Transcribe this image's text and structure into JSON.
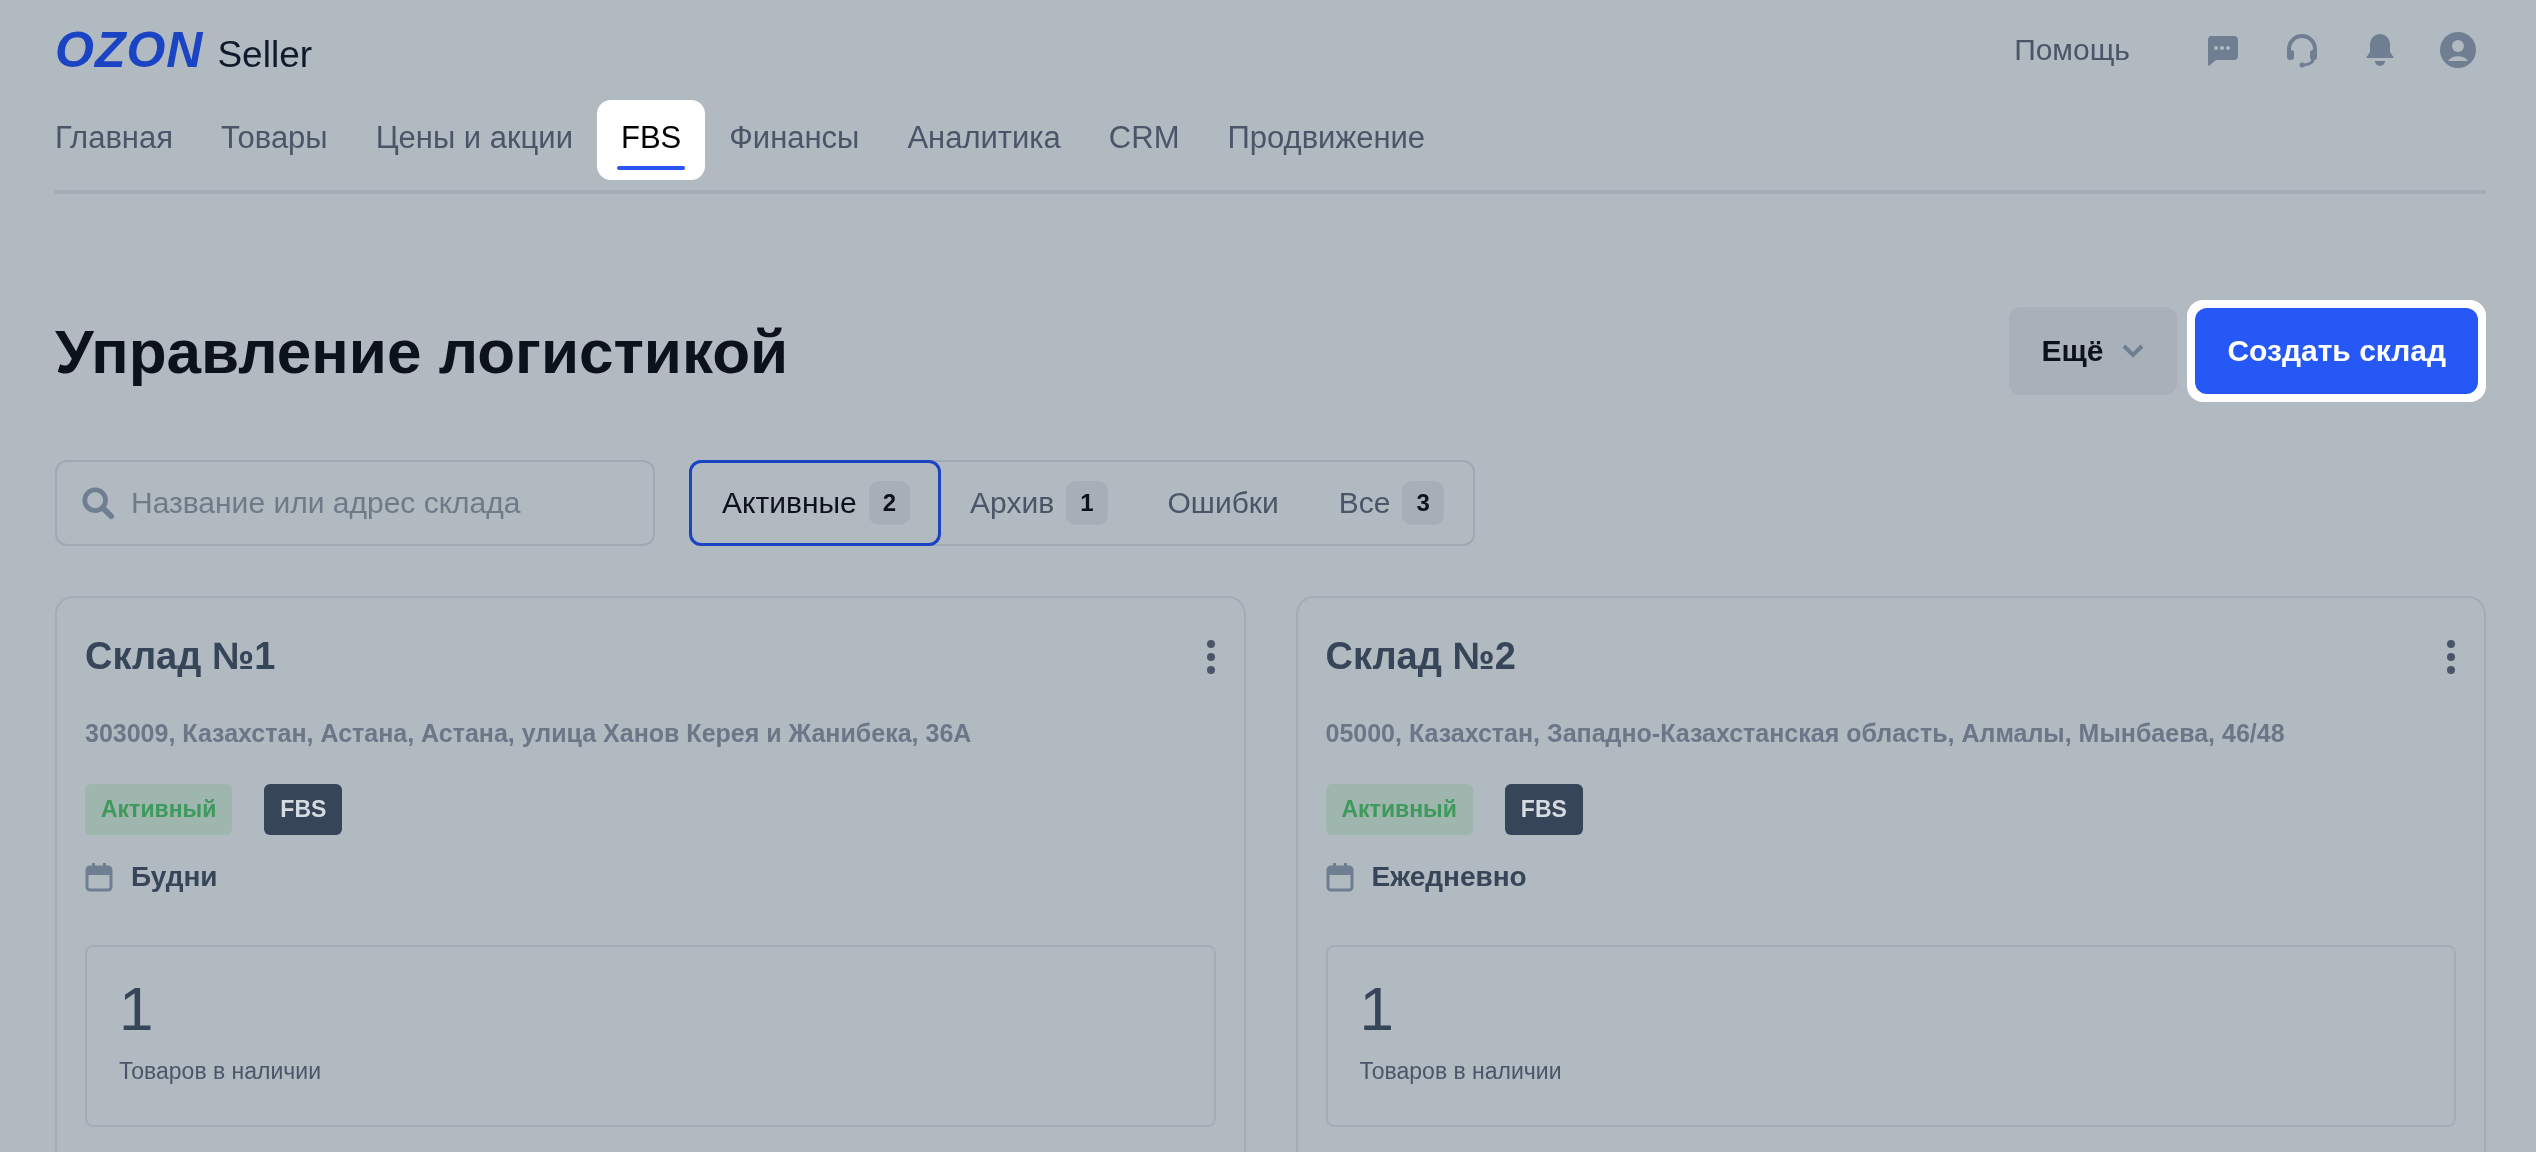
{
  "header": {
    "logo": "OZON",
    "logo_suffix": "Seller",
    "help": "Помощь"
  },
  "nav": [
    {
      "label": "Главная",
      "selected": false
    },
    {
      "label": "Товары",
      "selected": false
    },
    {
      "label": "Цены и акции",
      "selected": false
    },
    {
      "label": "FBS",
      "selected": true
    },
    {
      "label": "Финансы",
      "selected": false
    },
    {
      "label": "Аналитика",
      "selected": false
    },
    {
      "label": "CRM",
      "selected": false
    },
    {
      "label": "Продвижение",
      "selected": false
    }
  ],
  "page": {
    "title": "Управление логистикой",
    "more_button": "Ещё",
    "create_button": {
      "label": "Создать склад",
      "highlighted": true
    }
  },
  "search": {
    "placeholder": "Название или адрес склада"
  },
  "filters": [
    {
      "label": "Активные",
      "count": "2",
      "selected": true
    },
    {
      "label": "Архив",
      "count": "1",
      "selected": false
    },
    {
      "label": "Ошибки",
      "selected": false
    },
    {
      "label": "Все",
      "count": "3",
      "selected": false
    }
  ],
  "warehouses": [
    {
      "name": "Склад №1",
      "address": "303009, Казахстан, Астана, Астана, улица Ханов Керея и Жанибека, 36А",
      "status": "Активный",
      "type": "FBS",
      "schedule": "Будни",
      "stock_value": "1",
      "stock_label": "Товаров в наличии"
    },
    {
      "name": "Склад №2",
      "address": "05000, Казахстан, Западно-Казахстанская область, Алмалы, Мынбаева, 46/48",
      "status": "Активный",
      "type": "FBS",
      "schedule": "Ежедневно",
      "stock_value": "1",
      "stock_label": "Товаров в наличии"
    }
  ]
}
